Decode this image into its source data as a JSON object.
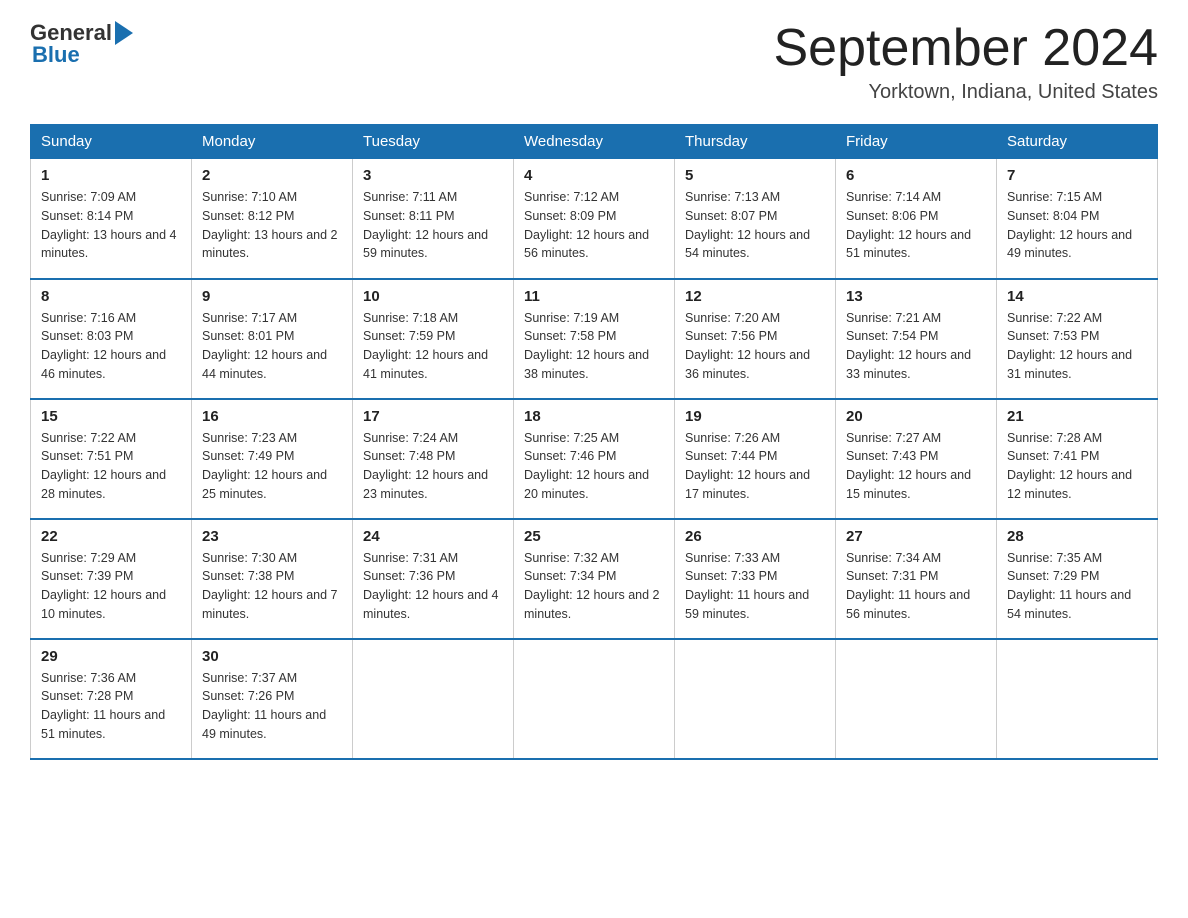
{
  "header": {
    "logo_general": "General",
    "logo_blue": "Blue",
    "month_title": "September 2024",
    "location": "Yorktown, Indiana, United States"
  },
  "weekdays": [
    "Sunday",
    "Monday",
    "Tuesday",
    "Wednesday",
    "Thursday",
    "Friday",
    "Saturday"
  ],
  "weeks": [
    [
      {
        "day": "1",
        "sunrise": "7:09 AM",
        "sunset": "8:14 PM",
        "daylight": "13 hours and 4 minutes."
      },
      {
        "day": "2",
        "sunrise": "7:10 AM",
        "sunset": "8:12 PM",
        "daylight": "13 hours and 2 minutes."
      },
      {
        "day": "3",
        "sunrise": "7:11 AM",
        "sunset": "8:11 PM",
        "daylight": "12 hours and 59 minutes."
      },
      {
        "day": "4",
        "sunrise": "7:12 AM",
        "sunset": "8:09 PM",
        "daylight": "12 hours and 56 minutes."
      },
      {
        "day": "5",
        "sunrise": "7:13 AM",
        "sunset": "8:07 PM",
        "daylight": "12 hours and 54 minutes."
      },
      {
        "day": "6",
        "sunrise": "7:14 AM",
        "sunset": "8:06 PM",
        "daylight": "12 hours and 51 minutes."
      },
      {
        "day": "7",
        "sunrise": "7:15 AM",
        "sunset": "8:04 PM",
        "daylight": "12 hours and 49 minutes."
      }
    ],
    [
      {
        "day": "8",
        "sunrise": "7:16 AM",
        "sunset": "8:03 PM",
        "daylight": "12 hours and 46 minutes."
      },
      {
        "day": "9",
        "sunrise": "7:17 AM",
        "sunset": "8:01 PM",
        "daylight": "12 hours and 44 minutes."
      },
      {
        "day": "10",
        "sunrise": "7:18 AM",
        "sunset": "7:59 PM",
        "daylight": "12 hours and 41 minutes."
      },
      {
        "day": "11",
        "sunrise": "7:19 AM",
        "sunset": "7:58 PM",
        "daylight": "12 hours and 38 minutes."
      },
      {
        "day": "12",
        "sunrise": "7:20 AM",
        "sunset": "7:56 PM",
        "daylight": "12 hours and 36 minutes."
      },
      {
        "day": "13",
        "sunrise": "7:21 AM",
        "sunset": "7:54 PM",
        "daylight": "12 hours and 33 minutes."
      },
      {
        "day": "14",
        "sunrise": "7:22 AM",
        "sunset": "7:53 PM",
        "daylight": "12 hours and 31 minutes."
      }
    ],
    [
      {
        "day": "15",
        "sunrise": "7:22 AM",
        "sunset": "7:51 PM",
        "daylight": "12 hours and 28 minutes."
      },
      {
        "day": "16",
        "sunrise": "7:23 AM",
        "sunset": "7:49 PM",
        "daylight": "12 hours and 25 minutes."
      },
      {
        "day": "17",
        "sunrise": "7:24 AM",
        "sunset": "7:48 PM",
        "daylight": "12 hours and 23 minutes."
      },
      {
        "day": "18",
        "sunrise": "7:25 AM",
        "sunset": "7:46 PM",
        "daylight": "12 hours and 20 minutes."
      },
      {
        "day": "19",
        "sunrise": "7:26 AM",
        "sunset": "7:44 PM",
        "daylight": "12 hours and 17 minutes."
      },
      {
        "day": "20",
        "sunrise": "7:27 AM",
        "sunset": "7:43 PM",
        "daylight": "12 hours and 15 minutes."
      },
      {
        "day": "21",
        "sunrise": "7:28 AM",
        "sunset": "7:41 PM",
        "daylight": "12 hours and 12 minutes."
      }
    ],
    [
      {
        "day": "22",
        "sunrise": "7:29 AM",
        "sunset": "7:39 PM",
        "daylight": "12 hours and 10 minutes."
      },
      {
        "day": "23",
        "sunrise": "7:30 AM",
        "sunset": "7:38 PM",
        "daylight": "12 hours and 7 minutes."
      },
      {
        "day": "24",
        "sunrise": "7:31 AM",
        "sunset": "7:36 PM",
        "daylight": "12 hours and 4 minutes."
      },
      {
        "day": "25",
        "sunrise": "7:32 AM",
        "sunset": "7:34 PM",
        "daylight": "12 hours and 2 minutes."
      },
      {
        "day": "26",
        "sunrise": "7:33 AM",
        "sunset": "7:33 PM",
        "daylight": "11 hours and 59 minutes."
      },
      {
        "day": "27",
        "sunrise": "7:34 AM",
        "sunset": "7:31 PM",
        "daylight": "11 hours and 56 minutes."
      },
      {
        "day": "28",
        "sunrise": "7:35 AM",
        "sunset": "7:29 PM",
        "daylight": "11 hours and 54 minutes."
      }
    ],
    [
      {
        "day": "29",
        "sunrise": "7:36 AM",
        "sunset": "7:28 PM",
        "daylight": "11 hours and 51 minutes."
      },
      {
        "day": "30",
        "sunrise": "7:37 AM",
        "sunset": "7:26 PM",
        "daylight": "11 hours and 49 minutes."
      },
      null,
      null,
      null,
      null,
      null
    ]
  ]
}
